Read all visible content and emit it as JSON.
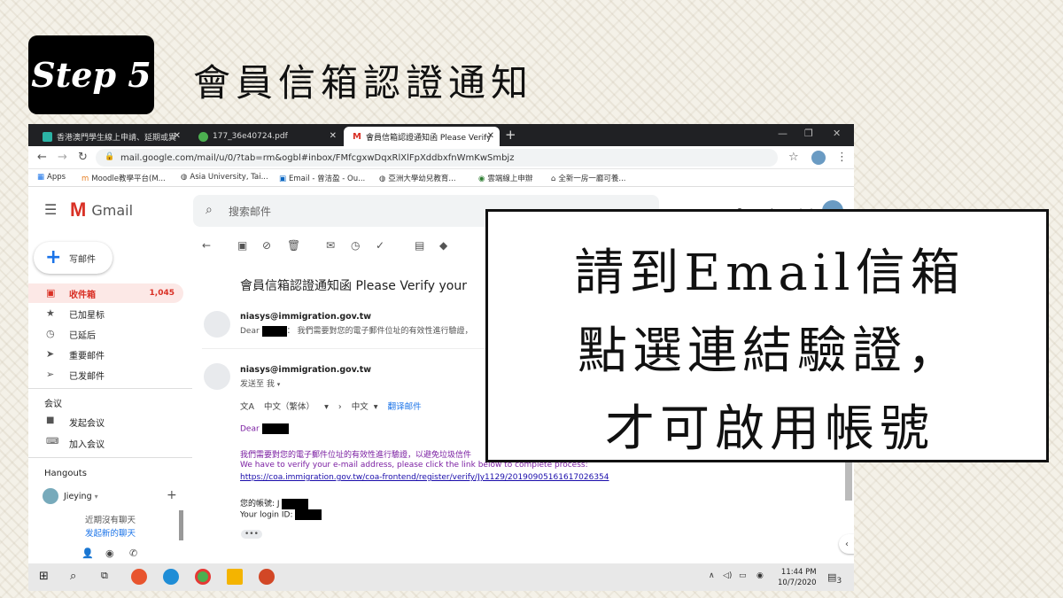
{
  "slide": {
    "step_label": "Step 5",
    "title": "會員信箱認證通知"
  },
  "browser": {
    "tabs": [
      {
        "label": "香港澳門學生線上申請、延期或異",
        "active": false
      },
      {
        "label": "177_36e40724.pdf",
        "active": false
      },
      {
        "label": "會員信箱認證通知函 Please Verify",
        "active": true
      }
    ],
    "url": "mail.google.com/mail/u/0/?tab=rm&ogbl#inbox/FMfcgxwDqxRlXlFpXddbxfnWmKwSmbjz",
    "bookmarks": [
      "Apps",
      "Moodle教學平台(M...",
      "Asia University, Tai...",
      "Email - 曾洁盈 - Ou...",
      "亞洲大學幼兒教育...",
      "雲端線上申辦",
      "全新一房一廳可養..."
    ]
  },
  "gmail": {
    "logo_text": "Gmail",
    "search_placeholder": "搜索邮件",
    "compose_label": "写邮件",
    "nav": [
      {
        "label": "收件箱",
        "count": "1,045",
        "icon": "inbox-icon"
      },
      {
        "label": "已加星标",
        "icon": "star-icon"
      },
      {
        "label": "已延后",
        "icon": "clock-icon"
      },
      {
        "label": "重要邮件",
        "icon": "important-icon"
      },
      {
        "label": "已发邮件",
        "icon": "send-icon"
      }
    ],
    "meet_title": "会议",
    "meet_items": [
      "发起会议",
      "加入会议"
    ],
    "hangouts_title": "Hangouts",
    "hangouts_user": "Jieying",
    "no_chats": "近期沒有聊天",
    "start_chat": "发起新的聊天",
    "subject": "會員信箱認證通知函 Please Verify your",
    "messages": [
      {
        "sender": "niasys@immigration.gov.tw",
        "snippet_prefix": "Dear",
        "snippet": "我們需要對您的電子郵件位址的有效性進行驗證，"
      },
      {
        "sender": "niasys@immigration.gov.tw",
        "to": "发送至 我"
      }
    ],
    "translate": {
      "from": "中文（繁体）",
      "to": "中文",
      "link": "翻译邮件"
    },
    "body": {
      "greeting": "Dear",
      "line1": "我們需要對您的電子郵件位址的有效性進行驗證，以避免垃圾信件",
      "line2": "We have to verify your e-mail address, please click the link below to complete process:",
      "link": "https://coa.immigration.gov.tw/coa-frontend/register/verify/Jy1129/20190905161617026354",
      "account_label": "您的帳號: J",
      "login_label": "Your login ID:"
    }
  },
  "taskbar": {
    "time": "11:44 PM",
    "date": "10/7/2020",
    "notification_count": "3"
  },
  "callout": {
    "line1": "請到Email信箱",
    "line2": "點選連結驗證，",
    "line3": "才可啟用帳號"
  },
  "colors": {
    "gmail_red": "#d93025",
    "link_blue": "#1a73e8",
    "body_purple": "#7b1fa2"
  }
}
